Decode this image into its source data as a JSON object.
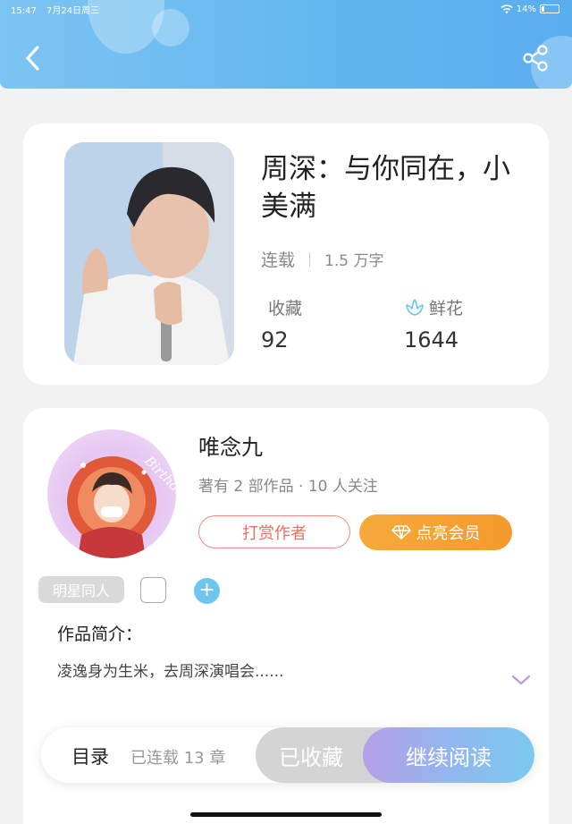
{
  "status_bar": {
    "time": "15:47",
    "date": "7月24日周三",
    "battery": "14%"
  },
  "header": {
    "back_icon": "chevron-left-icon",
    "share_icon": "share-icon"
  },
  "book": {
    "title": "周深：与你同在，小美满",
    "status": "连载",
    "word_count": "1.5 万字",
    "favorites_label": "收藏",
    "favorites_count": "92",
    "flowers_label": "鲜花",
    "flowers_count": "1644",
    "flower_icon": "flower-icon"
  },
  "author": {
    "name": "唯念九",
    "meta": "著有 2 部作品 · 10 人关注",
    "tip_button": "打赏作者",
    "vip_button": "点亮会员",
    "vip_icon": "diamond-icon",
    "avatar_text": "Birthday"
  },
  "tags": {
    "items": [
      "明星同人"
    ],
    "add_icon": "plus-icon"
  },
  "intro": {
    "label": "作品简介：",
    "text": "凌逸身为生米，去周深演唱会......",
    "expand_icon": "chevron-down-icon"
  },
  "bottom_bar": {
    "toc": "目录",
    "chapters": "已连载 13 章",
    "favorited": "已收藏",
    "continue": "继续阅读"
  },
  "colors": {
    "header": "#62b6f0",
    "accent_orange": "#f59a2c",
    "tip_red": "#e86f63",
    "flower_blue": "#6ec6ef"
  }
}
